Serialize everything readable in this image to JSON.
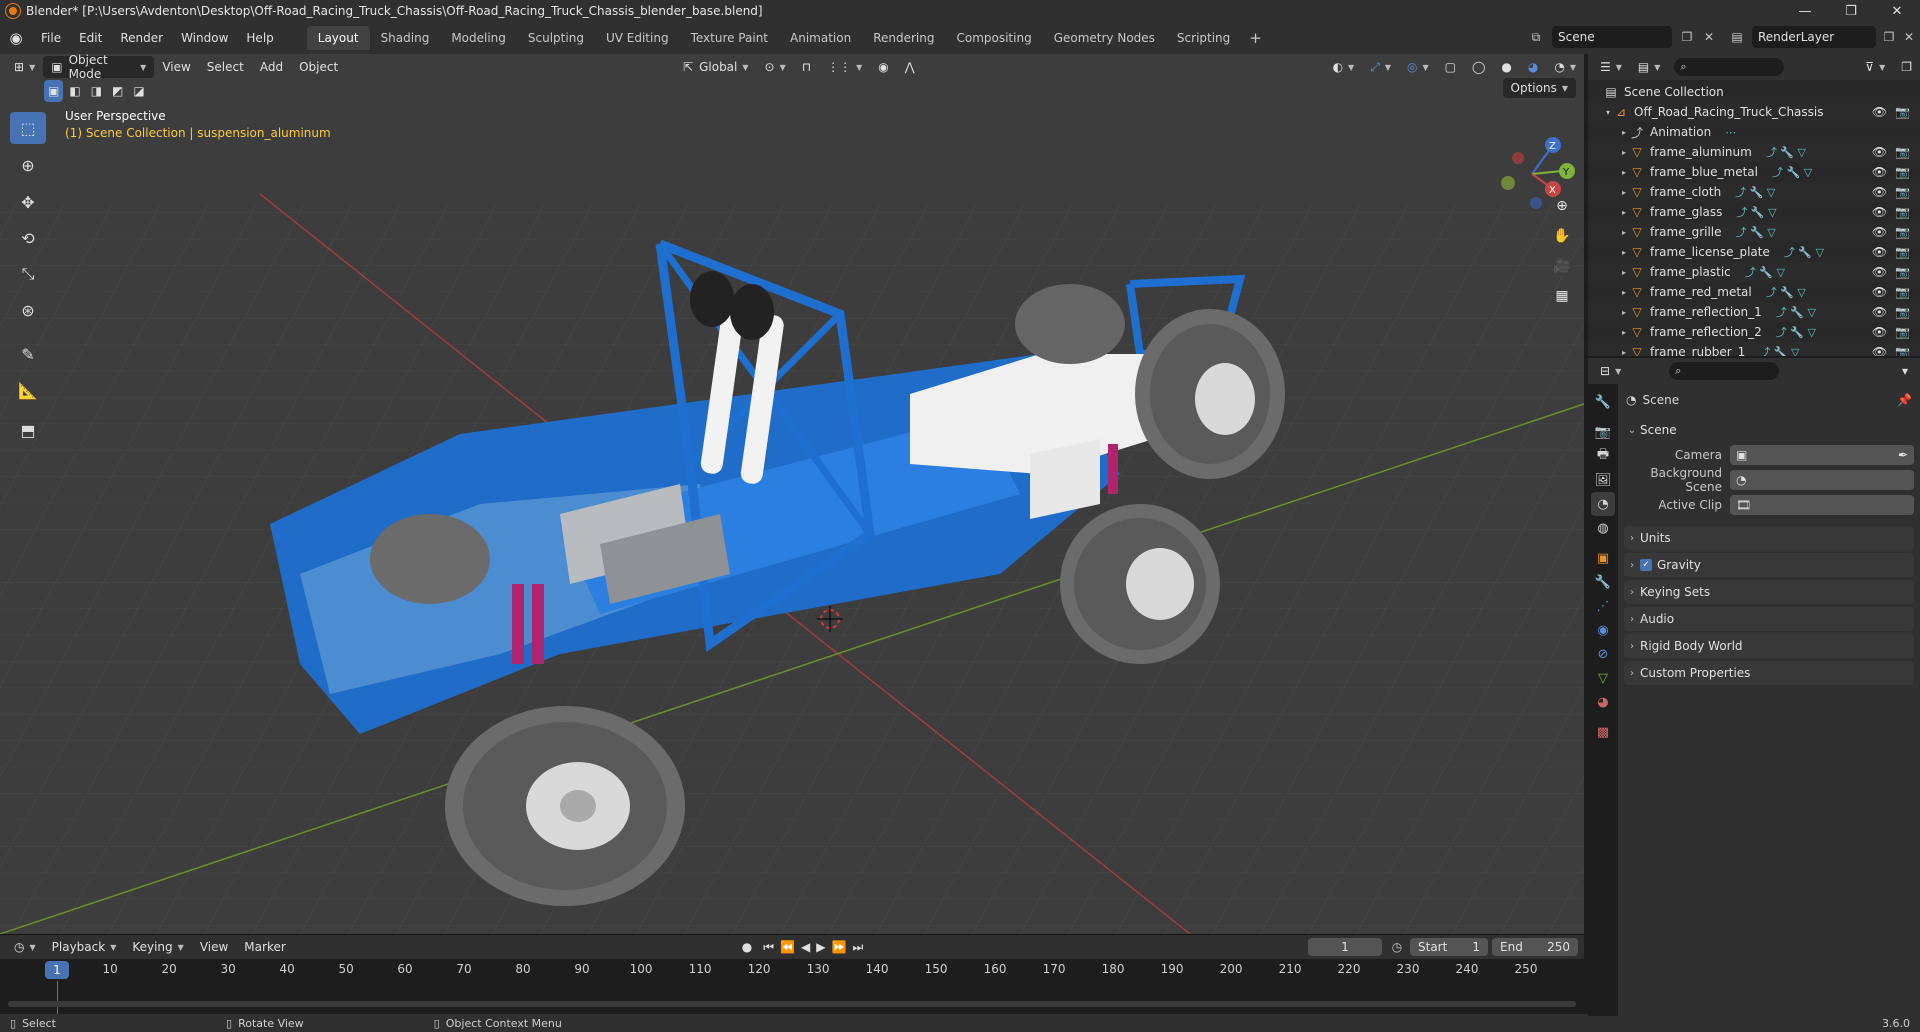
{
  "window": {
    "title": "Blender* [P:\\Users\\Avdenton\\Desktop\\Off-Road_Racing_Truck_Chassis\\Off-Road_Racing_Truck_Chassis_blender_base.blend]",
    "controls": [
      "—",
      "❐",
      "✕"
    ]
  },
  "menubar": {
    "menus": [
      "File",
      "Edit",
      "Render",
      "Window",
      "Help"
    ],
    "workspaces": [
      "Layout",
      "Shading",
      "Modeling",
      "Sculpting",
      "UV Editing",
      "Texture Paint",
      "Animation",
      "Rendering",
      "Compositing",
      "Geometry Nodes",
      "Scripting"
    ],
    "active_workspace": "Layout",
    "scene_name": "Scene",
    "view_layer": "RenderLayer"
  },
  "viewport": {
    "mode": "Object Mode",
    "menus": [
      "View",
      "Select",
      "Add",
      "Object"
    ],
    "orientation": "Global",
    "options_label": "Options",
    "view_name": "User Perspective",
    "context_info": "(1) Scene Collection | suspension_aluminum",
    "gizmo_axes": [
      "X",
      "Y",
      "Z"
    ]
  },
  "timeline": {
    "menus": [
      "Playback",
      "Keying",
      "View",
      "Marker"
    ],
    "current_frame": "1",
    "start_label": "Start",
    "start_value": "1",
    "end_label": "End",
    "end_value": "250",
    "ticks": [
      "1",
      "10",
      "20",
      "30",
      "40",
      "50",
      "60",
      "70",
      "80",
      "90",
      "100",
      "110",
      "120",
      "130",
      "140",
      "150",
      "160",
      "170",
      "180",
      "190",
      "200",
      "210",
      "220",
      "230",
      "240",
      "250"
    ]
  },
  "statusbar": {
    "items": [
      "Select",
      "Rotate View",
      "Object Context Menu"
    ],
    "version": "3.6.0"
  },
  "outliner": {
    "root": "Scene Collection",
    "collection": "Off_Road_Racing_Truck_Chassis",
    "items": [
      {
        "name": "Animation",
        "kind": "action"
      },
      {
        "name": "frame_aluminum",
        "kind": "object"
      },
      {
        "name": "frame_blue_metal",
        "kind": "object"
      },
      {
        "name": "frame_cloth",
        "kind": "object"
      },
      {
        "name": "frame_glass",
        "kind": "object"
      },
      {
        "name": "frame_grille",
        "kind": "object"
      },
      {
        "name": "frame_license_plate",
        "kind": "object"
      },
      {
        "name": "frame_plastic",
        "kind": "object"
      },
      {
        "name": "frame_red_metal",
        "kind": "object"
      },
      {
        "name": "frame_reflection_1",
        "kind": "object"
      },
      {
        "name": "frame_reflection_2",
        "kind": "object"
      },
      {
        "name": "frame_rubber_1",
        "kind": "object"
      }
    ]
  },
  "properties": {
    "context_title": "Scene",
    "panel_title": "Scene",
    "fields": [
      {
        "label": "Camera",
        "value": ""
      },
      {
        "label": "Background Scene",
        "value": ""
      },
      {
        "label": "Active Clip",
        "value": ""
      }
    ],
    "collapsed_panels": [
      "Units",
      "Gravity",
      "Keying Sets",
      "Audio",
      "Rigid Body World",
      "Custom Properties"
    ],
    "gravity_checked": true
  },
  "colors": {
    "accent": "#4772b3",
    "info_text": "#ffcc33",
    "object_icon": "#e8932d",
    "chassis_blue": "#1f6fd1",
    "x_axis": "#c94545",
    "y_axis": "#7fb33b"
  }
}
